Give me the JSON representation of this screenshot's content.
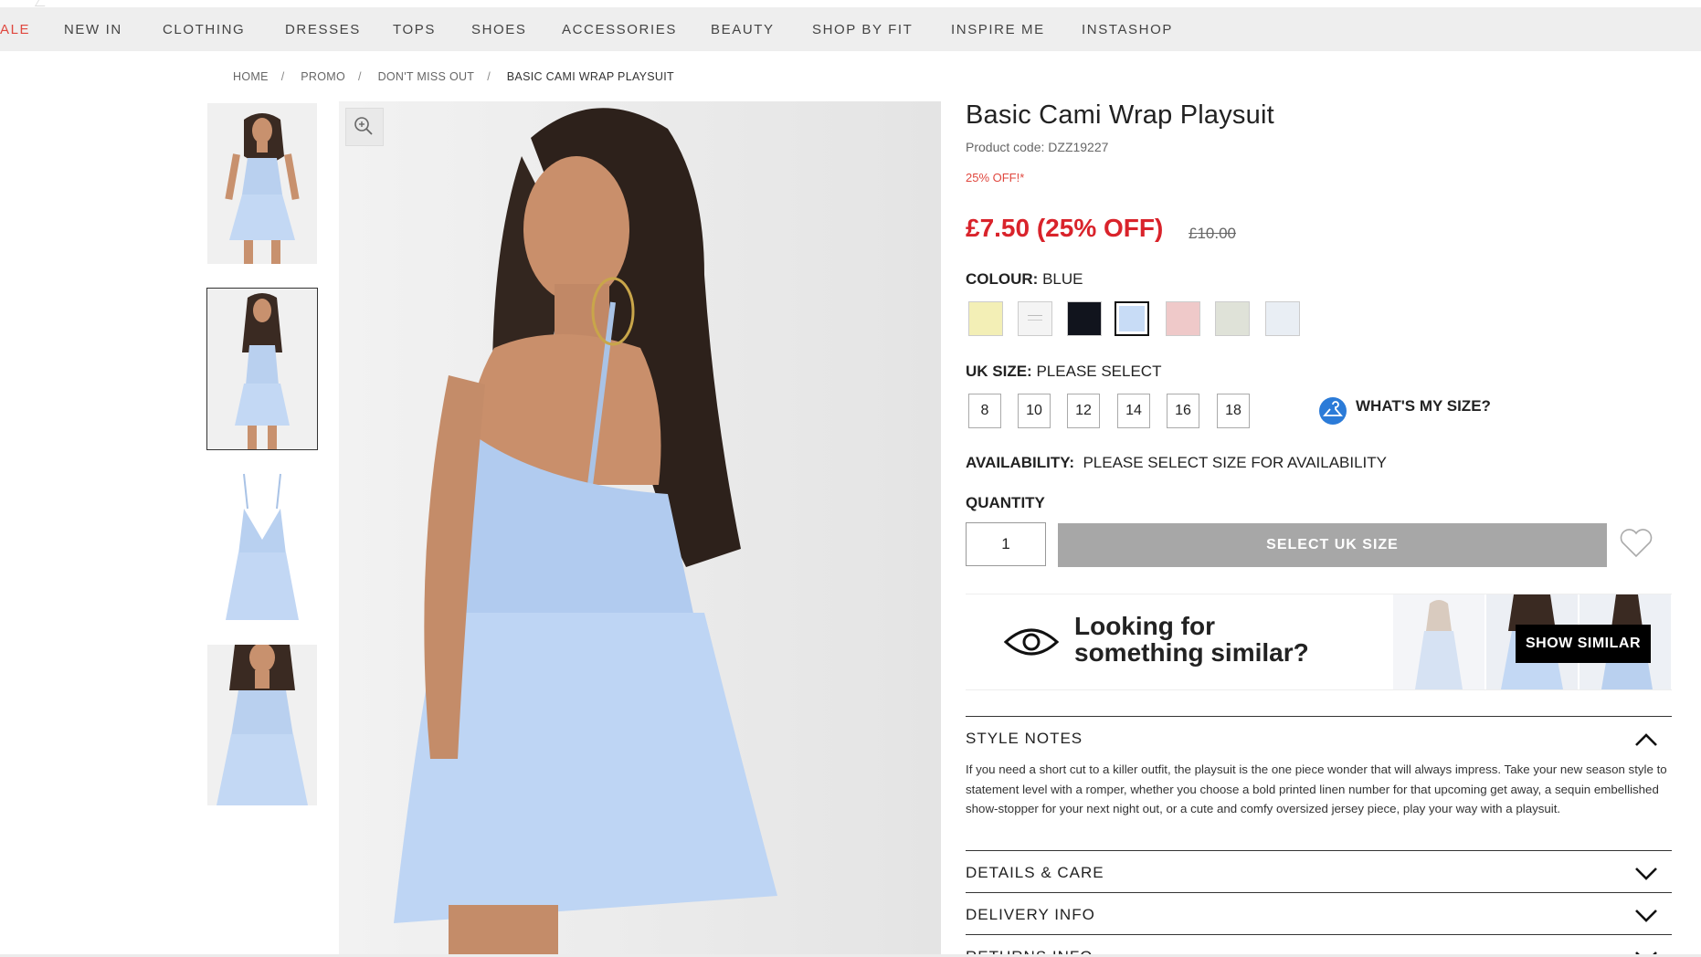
{
  "nav": {
    "items": [
      "ALE",
      "NEW IN",
      "CLOTHING",
      "DRESSES",
      "TOPS",
      "SHOES",
      "ACCESSORIES",
      "BEAUTY",
      "SHOP BY FIT",
      "INSPIRE ME",
      "INSTASHOP"
    ]
  },
  "breadcrumb": [
    "HOME",
    "PROMO",
    "DON'T MISS OUT",
    "BASIC CAMI WRAP PLAYSUIT"
  ],
  "product": {
    "title": "Basic Cami Wrap Playsuit",
    "code": "Product code: DZZ19227",
    "discount_note": "25% OFF!*",
    "price": "£7.50 (25% OFF)",
    "was_price": "£10.00",
    "colour_label": "COLOUR:",
    "colour_value": "BLUE",
    "size_label": "UK SIZE:",
    "size_value": "PLEASE SELECT",
    "sizes": [
      "8",
      "10",
      "12",
      "14",
      "16",
      "18"
    ],
    "whats_my_size": "WHAT'S MY SIZE?",
    "availability_label": "AVAILABILITY:",
    "availability_value": "PLEASE SELECT SIZE FOR AVAILABILITY",
    "quantity_label": "QUANTITY",
    "quantity_value": "1",
    "add_button": "SELECT UK SIZE"
  },
  "swatch_colors": [
    "#f3efb6",
    "#f4f4f4",
    "#11141d",
    "#c8dcf6",
    "#efc9c9",
    "#dfe2d8",
    "#e9eef4"
  ],
  "similar": {
    "line1": "Looking for",
    "line2": "something similar?",
    "button": "SHOW SIMILAR"
  },
  "accordion": {
    "style_notes": "STYLE NOTES",
    "style_notes_text": "If you need a short cut to a killer outfit, the playsuit is the one piece wonder that will always impress. Take your new season style to statement level with a romper, whether you choose a bold printed linen number for that upcoming get away, a sequin embellished show-stopper for your next night out, or a cute and comfy oversized jersey piece, play your way with a playsuit.",
    "details": "DETAILS & CARE",
    "delivery": "DELIVERY INFO",
    "returns": "RETURNS INFO"
  }
}
